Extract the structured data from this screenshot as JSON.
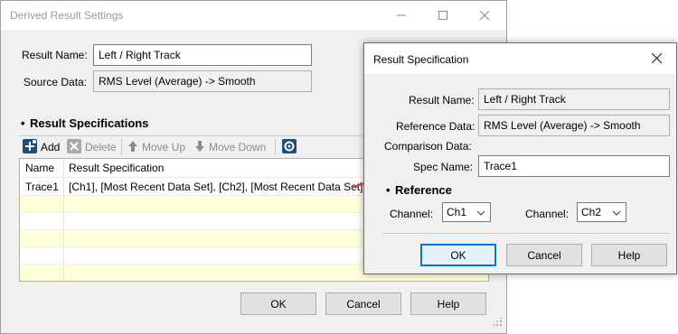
{
  "back_dialog": {
    "title": "Derived Result Settings",
    "result_name_label": "Result Name:",
    "result_name_value": "Left / Right Track",
    "source_data_label": "Source Data:",
    "source_data_value": "RMS Level (Average) -> Smooth",
    "section_bullet": "•",
    "section_title": "Result Specifications",
    "toolbar": {
      "add": "Add",
      "delete": "Delete",
      "move_up": "Move Up",
      "move_down": "Move Down"
    },
    "table": {
      "columns": [
        "Name",
        "Result Specification"
      ],
      "rows": [
        [
          "Trace1",
          "[Ch1], [Most Recent Data Set], [Ch2], [Most Recent Data Set]"
        ]
      ]
    },
    "buttons": {
      "ok": "OK",
      "cancel": "Cancel",
      "help": "Help"
    }
  },
  "front_dialog": {
    "title": "Result Specification",
    "result_name_label": "Result Name:",
    "result_name_value": "Left / Right Track",
    "reference_data_label": "Reference Data:",
    "reference_data_value": "RMS Level (Average) -> Smooth",
    "comparison_data_label": "Comparison Data:",
    "spec_name_label": "Spec Name:",
    "spec_name_value": "Trace1",
    "section_bullet": "•",
    "reference_title": "Reference",
    "channel_label_1": "Channel:",
    "channel_value_1": "Ch1",
    "channel_label_2": "Channel:",
    "channel_value_2": "Ch2",
    "buttons": {
      "ok": "OK",
      "cancel": "Cancel",
      "help": "Help"
    }
  },
  "colors": {
    "accent": "#0078d7",
    "arrow": "#e03c31",
    "row_highlight": "#ffffe1"
  }
}
